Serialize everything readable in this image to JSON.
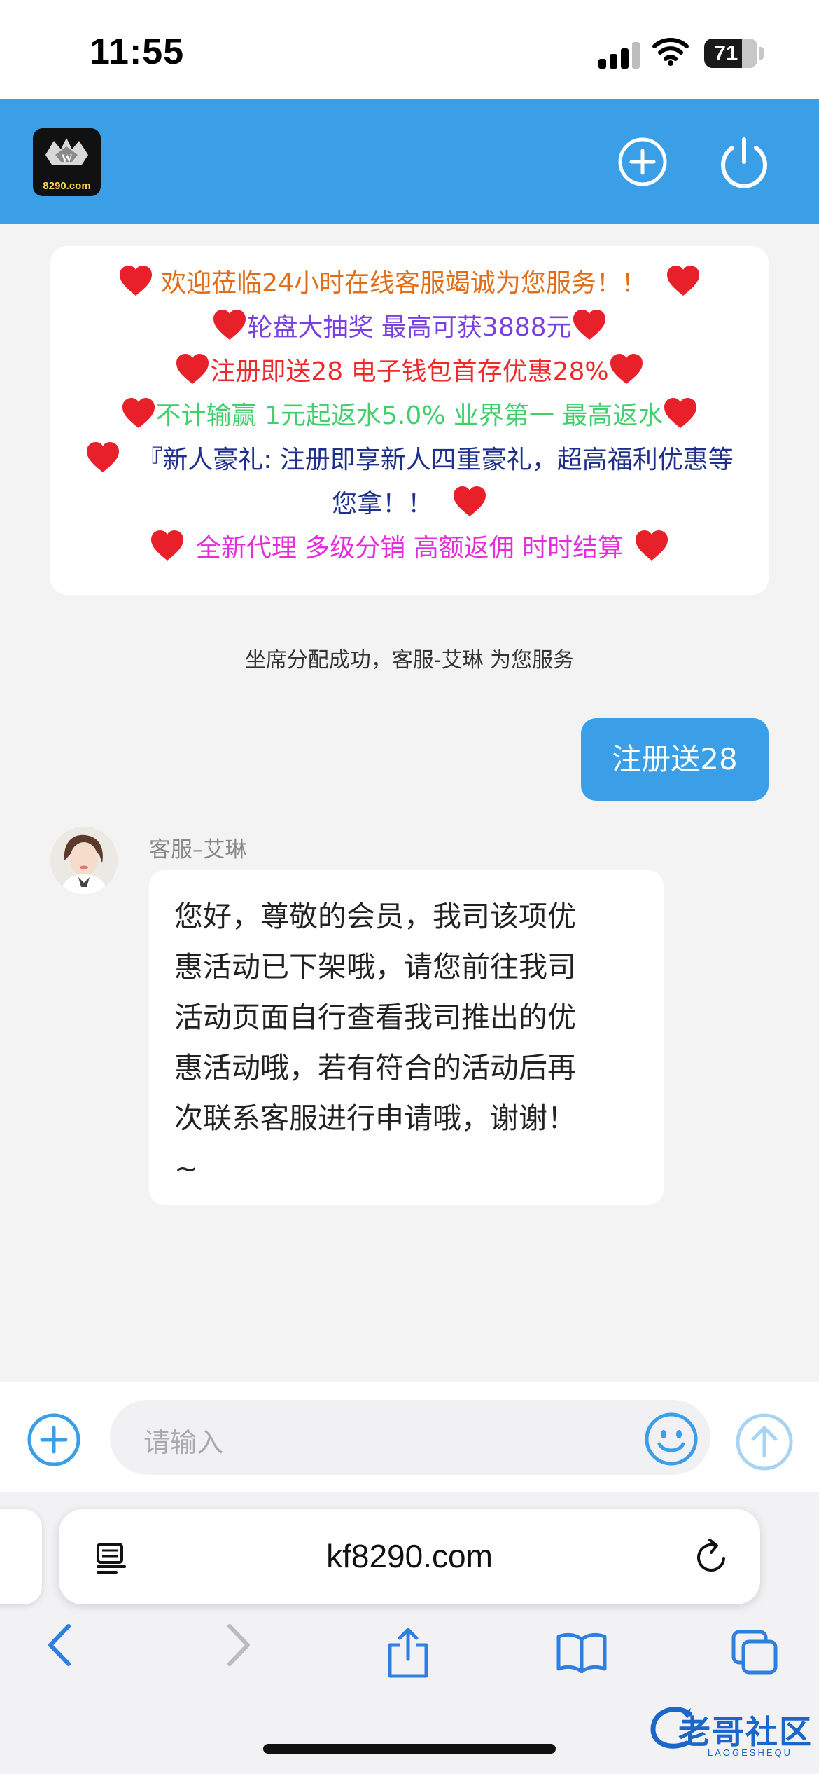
{
  "status": {
    "time": "11:55",
    "battery": "71"
  },
  "header": {
    "logo_text": "8290.com"
  },
  "notice": {
    "line1": "欢迎莅临24小时在线客服竭诚为您服务！！",
    "line2": "轮盘大抽奖 最高可获3888元",
    "line3": "注册即送28 电子钱包首存优惠28%",
    "line4": "不计输赢 1元起返水5.0% 业界第一 最高返水",
    "line5a": "『新人豪礼: 注册即享新人四重豪礼，超高福利优惠等",
    "line5b": "您拿！！",
    "line6": "全新代理 多级分销 高额返佣 时时结算"
  },
  "system_message": "坐席分配成功，客服-艾琳 为您服务",
  "outgoing": {
    "text": "注册送28"
  },
  "incoming": {
    "agent_name": "客服–艾琳",
    "lines": [
      "您好，尊敬的会员，我司该项优",
      "惠活动已下架哦，请您前往我司",
      "活动页面自行查看我司推出的优",
      "惠活动哦，若有符合的活动后再",
      "次联系客服进行申请哦，谢谢！",
      "~"
    ]
  },
  "input": {
    "placeholder": "请输入"
  },
  "browser": {
    "url": "kf8290.com"
  },
  "watermark": {
    "text": "老哥社区",
    "sub": "LAOGESHEQU"
  },
  "colors": {
    "accent": "#3b9fe8",
    "heart": "#e8202a"
  },
  "icons": [
    "plus-circle-icon",
    "power-icon",
    "heart-icon",
    "smile-icon",
    "send-arrow-icon",
    "reader-icon",
    "reload-icon",
    "back-icon",
    "forward-icon",
    "share-icon",
    "bookmarks-icon",
    "tabs-icon"
  ]
}
